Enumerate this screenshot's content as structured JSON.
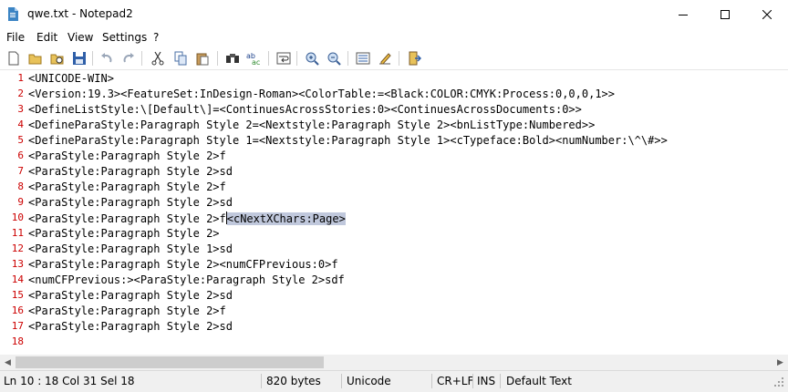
{
  "window": {
    "title": "qwe.txt - Notepad2"
  },
  "menu": [
    "File",
    "Edit",
    "View",
    "Settings",
    "?"
  ],
  "toolbar": [
    "new-file-icon",
    "open-file-icon",
    "browse-icon",
    "save-icon",
    "undo-icon",
    "redo-icon",
    "cut-icon",
    "copy-icon",
    "paste-icon",
    "find-icon",
    "replace-icon",
    "word-wrap-icon",
    "zoom-in-icon",
    "zoom-out-icon",
    "schemes-icon",
    "customize-schemes-icon",
    "exit-icon"
  ],
  "editor": {
    "selection_line": 10,
    "lines": [
      {
        "n": "1",
        "text": "<UNICODE-WIN>"
      },
      {
        "n": "2",
        "text": "<Version:19.3><FeatureSet:InDesign-Roman><ColorTable:=<Black:COLOR:CMYK:Process:0,0,0,1>>"
      },
      {
        "n": "3",
        "text": "<DefineListStyle:\\[Default\\]=<ContinuesAcrossStories:0><ContinuesAcrossDocuments:0>>"
      },
      {
        "n": "4",
        "text": "<DefineParaStyle:Paragraph Style 2=<Nextstyle:Paragraph Style 2><bnListType:Numbered>>"
      },
      {
        "n": "5",
        "text": "<DefineParaStyle:Paragraph Style 1=<Nextstyle:Paragraph Style 1><cTypeface:Bold><numNumber:\\^\\#>>"
      },
      {
        "n": "6",
        "text": "<ParaStyle:Paragraph Style 2>f"
      },
      {
        "n": "7",
        "text": "<ParaStyle:Paragraph Style 2>sd"
      },
      {
        "n": "8",
        "text": "<ParaStyle:Paragraph Style 2>f"
      },
      {
        "n": "9",
        "text": "<ParaStyle:Paragraph Style 2>sd"
      },
      {
        "n": "10",
        "text": "<ParaStyle:Paragraph Style 2>f",
        "selected": "<cNextXChars:Page>"
      },
      {
        "n": "11",
        "text": "<ParaStyle:Paragraph Style 2>"
      },
      {
        "n": "12",
        "text": "<ParaStyle:Paragraph Style 1>sd"
      },
      {
        "n": "13",
        "text": "<ParaStyle:Paragraph Style 2><numCFPrevious:0>f"
      },
      {
        "n": "14",
        "text": "<numCFPrevious:><ParaStyle:Paragraph Style 2>sdf"
      },
      {
        "n": "15",
        "text": "<ParaStyle:Paragraph Style 2>sd"
      },
      {
        "n": "16",
        "text": "<ParaStyle:Paragraph Style 2>f"
      },
      {
        "n": "17",
        "text": "<ParaStyle:Paragraph Style 2>sd"
      },
      {
        "n": "18",
        "text": ""
      }
    ]
  },
  "status": {
    "position": "Ln 10 : 18   Col 31   Sel 18",
    "size": "820 bytes",
    "encoding": "Unicode",
    "line_endings": "CR+LF",
    "mode": "INS",
    "scheme": "Default Text"
  },
  "colors": {
    "line_number": "#cc0000",
    "selection": "#c0c8dc",
    "status_bg": "#f0f0f0"
  }
}
